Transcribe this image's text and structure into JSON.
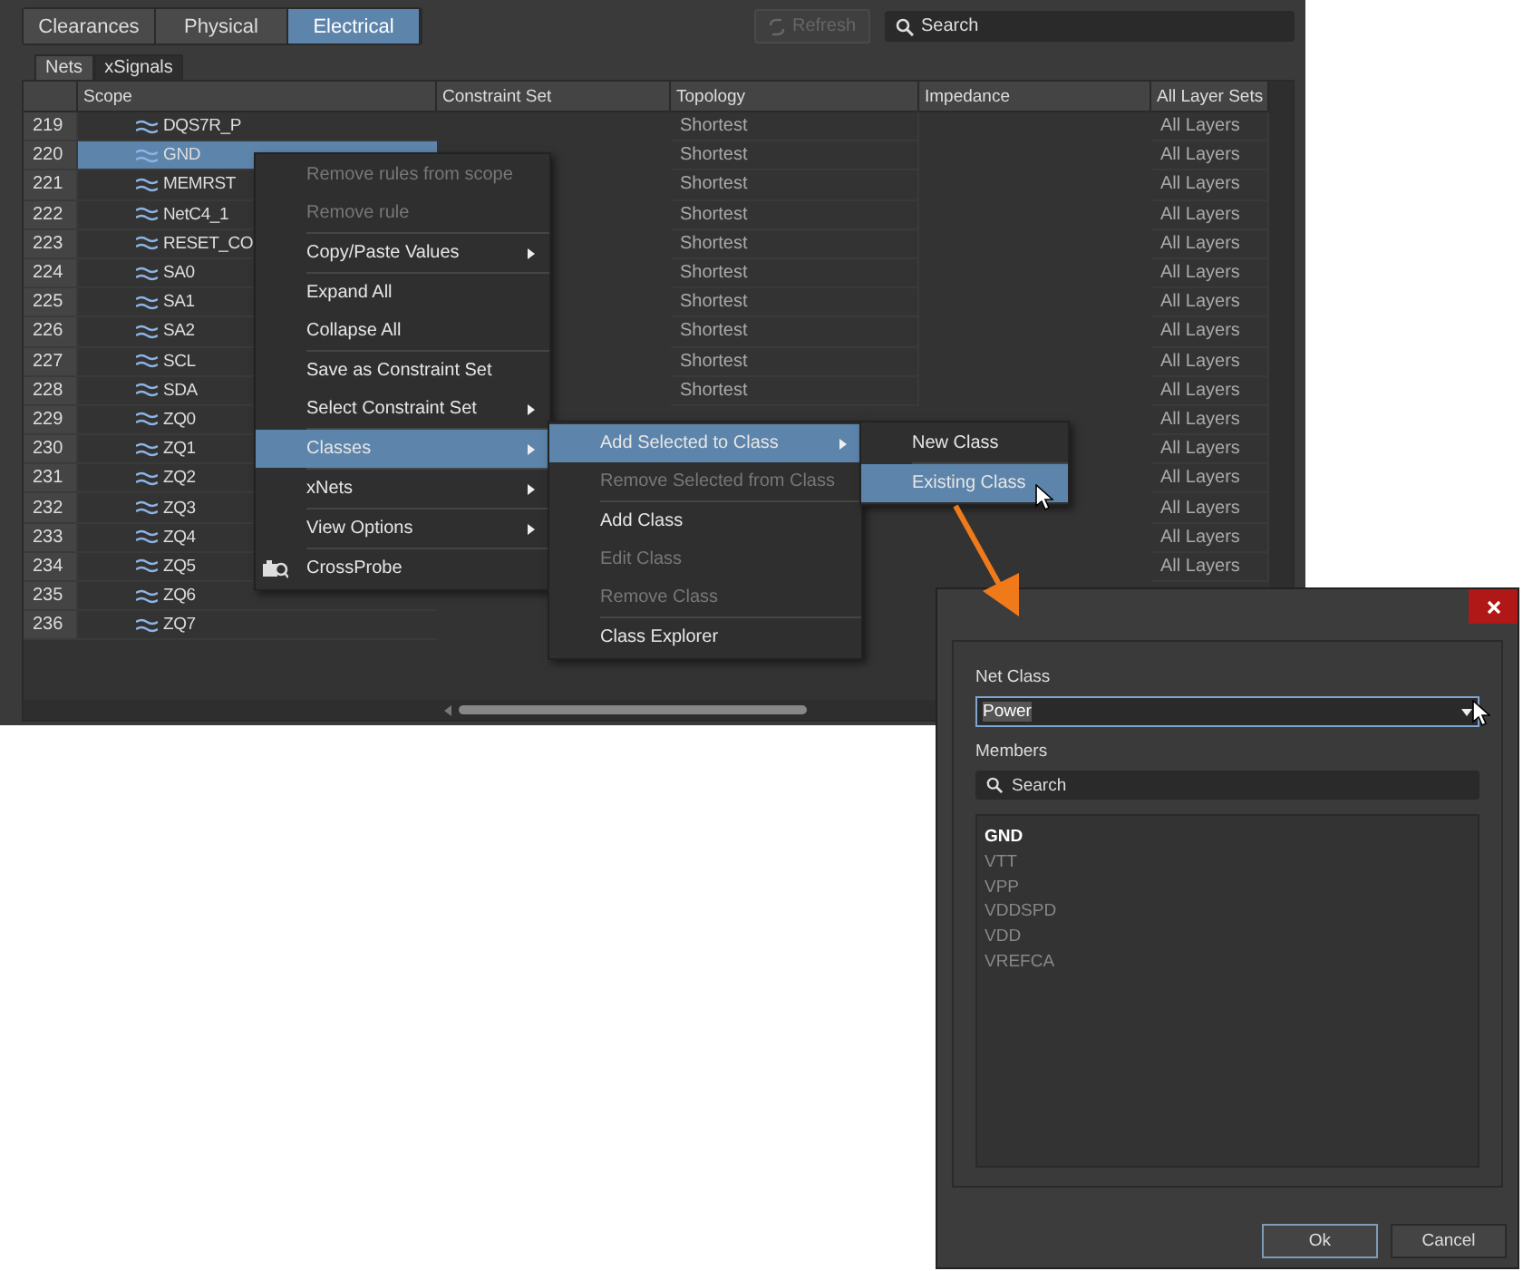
{
  "tabs": [
    {
      "label": "Clearances",
      "selected": false
    },
    {
      "label": "Physical",
      "selected": false
    },
    {
      "label": "Electrical",
      "selected": true
    }
  ],
  "toolbar": {
    "refresh": {
      "label": "Refresh",
      "disabled": true
    },
    "search": {
      "placeholder": "Search"
    }
  },
  "subtabs": [
    {
      "label": "Nets",
      "selected": true
    },
    {
      "label": "xSignals",
      "selected": false
    }
  ],
  "table": {
    "columns": [
      "Scope",
      "Constraint Set",
      "Topology",
      "Impedance",
      "All Layer Sets"
    ],
    "rows": [
      {
        "number": "219",
        "scope": "DQS7R_P",
        "topology": "Shortest",
        "layers": "All Layers",
        "selected": false
      },
      {
        "number": "220",
        "scope": "GND",
        "topology": "Shortest",
        "layers": "All Layers",
        "selected": true
      },
      {
        "number": "221",
        "scope": "MEMRST",
        "topology": "Shortest",
        "layers": "All Layers",
        "selected": false
      },
      {
        "number": "222",
        "scope": "NetC4_1",
        "topology": "Shortest",
        "layers": "All Layers",
        "selected": false
      },
      {
        "number": "223",
        "scope": "RESET_CO",
        "topology": "Shortest",
        "layers": "All Layers",
        "selected": false
      },
      {
        "number": "224",
        "scope": "SA0",
        "topology": "Shortest",
        "layers": "All Layers",
        "selected": false
      },
      {
        "number": "225",
        "scope": "SA1",
        "topology": "Shortest",
        "layers": "All Layers",
        "selected": false
      },
      {
        "number": "226",
        "scope": "SA2",
        "topology": "Shortest",
        "layers": "All Layers",
        "selected": false
      },
      {
        "number": "227",
        "scope": "SCL",
        "topology": "Shortest",
        "layers": "All Layers",
        "selected": false
      },
      {
        "number": "228",
        "scope": "SDA",
        "topology": "Shortest",
        "layers": "All Layers",
        "selected": false
      },
      {
        "number": "229",
        "scope": "ZQ0",
        "layers": "All Layers",
        "selected": false
      },
      {
        "number": "230",
        "scope": "ZQ1",
        "layers": "All Layers",
        "selected": false
      },
      {
        "number": "231",
        "scope": "ZQ2",
        "layers": "All Layers",
        "selected": false
      },
      {
        "number": "232",
        "scope": "ZQ3",
        "layers": "All Layers",
        "selected": false
      },
      {
        "number": "233",
        "scope": "ZQ4",
        "layers": "All Layers",
        "selected": false
      },
      {
        "number": "234",
        "scope": "ZQ5",
        "layers": "All Layers",
        "selected": false
      },
      {
        "number": "235",
        "scope": "ZQ6",
        "selected": false
      },
      {
        "number": "236",
        "scope": "ZQ7",
        "selected": false
      }
    ]
  },
  "context_menu": {
    "groups": [
      [
        {
          "label": "Remove rules from scope",
          "disabled": true,
          "submenu": false,
          "highlighted": false
        },
        {
          "label": "Remove rule",
          "disabled": true,
          "submenu": false,
          "highlighted": false
        }
      ],
      [
        {
          "label": "Copy/Paste Values",
          "disabled": false,
          "submenu": true,
          "highlighted": false
        }
      ],
      [
        {
          "label": "Expand All",
          "disabled": false,
          "submenu": false,
          "highlighted": false
        },
        {
          "label": "Collapse All",
          "disabled": false,
          "submenu": false,
          "highlighted": false
        }
      ],
      [
        {
          "label": "Save as Constraint Set",
          "disabled": false,
          "submenu": false,
          "highlighted": false
        },
        {
          "label": "Select Constraint Set",
          "disabled": false,
          "submenu": true,
          "highlighted": false
        }
      ],
      [
        {
          "label": "Classes",
          "disabled": false,
          "submenu": true,
          "highlighted": true
        }
      ],
      [
        {
          "label": "xNets",
          "disabled": false,
          "submenu": true,
          "highlighted": false
        }
      ],
      [
        {
          "label": "View Options",
          "disabled": false,
          "submenu": true,
          "highlighted": false
        }
      ],
      [
        {
          "label": "CrossProbe",
          "disabled": false,
          "submenu": false,
          "highlighted": false,
          "icon": true
        }
      ]
    ]
  },
  "classes_menu": {
    "groups": [
      [
        {
          "label": "Add Selected to Class",
          "disabled": false,
          "submenu": true,
          "highlighted": true
        },
        {
          "label": "Remove Selected from Class",
          "disabled": true,
          "submenu": false,
          "highlighted": false
        }
      ],
      [
        {
          "label": "Add Class",
          "disabled": false,
          "submenu": false,
          "highlighted": false
        },
        {
          "label": "Edit Class",
          "disabled": true,
          "submenu": false,
          "highlighted": false
        },
        {
          "label": "Remove Class",
          "disabled": true,
          "submenu": false,
          "highlighted": false
        }
      ],
      [
        {
          "label": "Class Explorer",
          "disabled": false,
          "submenu": false,
          "highlighted": false
        }
      ]
    ]
  },
  "add_menu": {
    "groups": [
      [
        {
          "label": "New Class",
          "disabled": false,
          "submenu": false,
          "highlighted": false
        }
      ],
      [
        {
          "label": "Existing Class",
          "disabled": false,
          "submenu": false,
          "highlighted": true
        }
      ]
    ]
  },
  "dialog": {
    "net_class_label": "Net Class",
    "net_class_value": "Power",
    "members_label": "Members",
    "search_placeholder": "Search",
    "members": [
      {
        "name": "GND",
        "highlighted": true
      },
      {
        "name": "VTT",
        "highlighted": false
      },
      {
        "name": "VPP",
        "highlighted": false
      },
      {
        "name": "VDDSPD",
        "highlighted": false
      },
      {
        "name": "VDD",
        "highlighted": false
      },
      {
        "name": "VREFCA",
        "highlighted": false
      }
    ],
    "buttons": [
      {
        "label": "Ok",
        "default": true
      },
      {
        "label": "Cancel",
        "default": false
      }
    ]
  }
}
